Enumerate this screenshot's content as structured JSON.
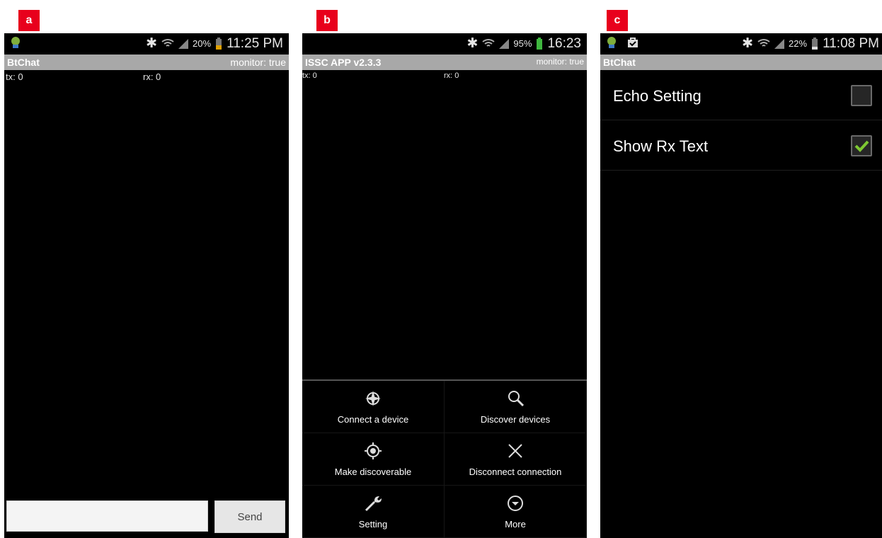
{
  "panels": [
    {
      "label": "a",
      "status": {
        "percent": "20%",
        "time": "11:25 PM"
      },
      "title": "BtChat",
      "monitor": "monitor: true",
      "tx": "tx: 0",
      "rx": "rx: 0",
      "send_label": "Send",
      "input_value": ""
    },
    {
      "label": "b",
      "status": {
        "percent": "95%",
        "time": "16:23"
      },
      "title": "ISSC APP v2.3.3",
      "monitor": "monitor: true",
      "tx": "tx: 0",
      "rx": "rx: 0",
      "menu": [
        {
          "label": "Connect a device",
          "icon": "compass-icon"
        },
        {
          "label": "Discover devices",
          "icon": "search-icon"
        },
        {
          "label": "Make discoverable",
          "icon": "target-icon"
        },
        {
          "label": "Disconnect connection",
          "icon": "close-icon"
        },
        {
          "label": "Setting",
          "icon": "wrench-icon"
        },
        {
          "label": "More",
          "icon": "chevron-down-circle-icon"
        }
      ]
    },
    {
      "label": "c",
      "status": {
        "percent": "22%",
        "time": "11:08 PM"
      },
      "title": "BtChat",
      "prefs": [
        {
          "label": "Echo Setting",
          "checked": false
        },
        {
          "label": "Show Rx Text",
          "checked": true
        }
      ]
    }
  ],
  "colors": {
    "accent_check": "#7ec832",
    "label_red": "#e8001c",
    "titlebar_gray": "#a8a8a8"
  }
}
